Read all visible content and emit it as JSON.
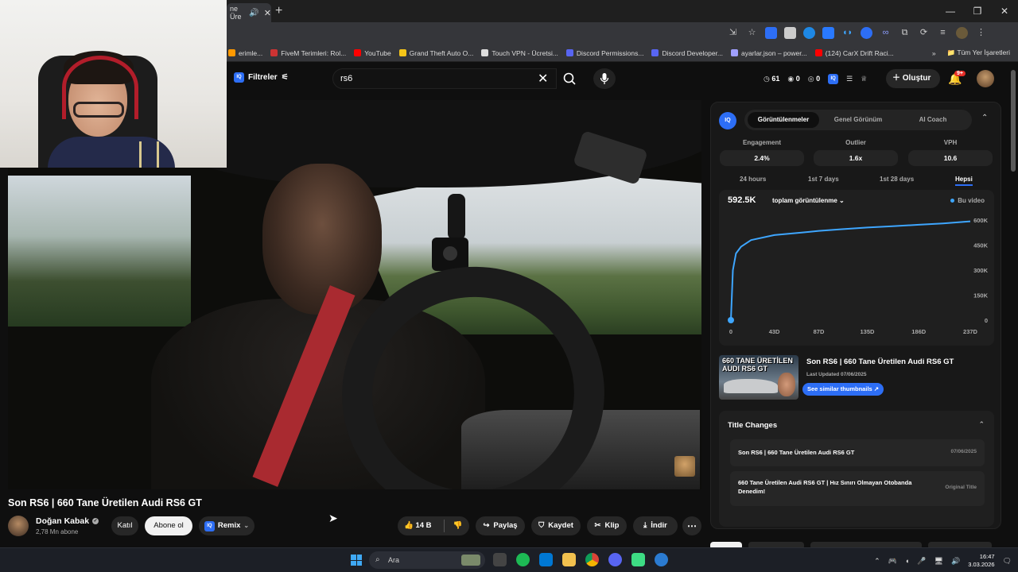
{
  "browser": {
    "active_tab_title": "ne Üre",
    "bookmarks": [
      {
        "label": "erimle...",
        "color": "#ff9900"
      },
      {
        "label": "FiveM Terimleri: Rol...",
        "color": "#cc3333"
      },
      {
        "label": "YouTube",
        "color": "#ff0000"
      },
      {
        "label": "Grand Theft Auto O...",
        "color": "#f5c518"
      },
      {
        "label": "Touch VPN - Ücretsi...",
        "color": "#dddddd"
      },
      {
        "label": "Discord Permissions...",
        "color": "#5865f2"
      },
      {
        "label": "Discord Developer...",
        "color": "#5865f2"
      },
      {
        "label": "ayarlar.json – power...",
        "color": "#a0a0ff"
      },
      {
        "label": "(124) CarX Drift Raci...",
        "color": "#ff0000"
      }
    ],
    "all_bookmarks": "Tüm Yer İşaretleri"
  },
  "header": {
    "filters_label": "Filtreler",
    "search_value": "rs6",
    "stats": [
      "61",
      "0",
      "0"
    ],
    "create_label": "Oluştur",
    "notif_count": "9+"
  },
  "video": {
    "title": "Son RS6 | 660 Tane Üretilen Audi RS6 GT",
    "channel": "Doğan Kabak",
    "subscribers": "2,78 Mn abone",
    "join_label": "Katıl",
    "subscribe_label": "Abone ol",
    "remix_label": "Remix",
    "likes": "14 B",
    "share_label": "Paylaş",
    "save_label": "Kaydet",
    "clip_label": "Klip",
    "download_label": "İndir"
  },
  "panel": {
    "tabs": [
      "Görüntülenmeler",
      "Genel Görünüm",
      "AI Coach"
    ],
    "metrics": [
      {
        "label": "Engagement",
        "value": "2.4%"
      },
      {
        "label": "Outlier",
        "value": "1.6x"
      },
      {
        "label": "VPH",
        "value": "10.6"
      }
    ],
    "periods": [
      "24 hours",
      "1st 7 days",
      "1st 28 days",
      "Hepsi"
    ],
    "active_period": "Hepsi",
    "total_views": "592.5K",
    "metric_select": "toplam görüntülenme",
    "legend": "Bu video",
    "thumb_text": "660 TANE ÜRETİLEN AUDI RS6 GT",
    "thumb_title": "Son RS6 | 660 Tane Üretilen Audi RS6 GT",
    "last_updated": "Last Updated 07/06/2025",
    "similar_label": "See similar thumbnails",
    "title_changes_heading": "Title Changes",
    "title_changes": [
      {
        "title": "Son RS6 | 660 Tane Üretilen Audi RS6 GT",
        "date": "07/06/2025"
      },
      {
        "title": "660 Tane Üretilen Audi RS6 GT | Hız Sınırı Olmayan Otobanda Denedim!",
        "date": "Original Title"
      }
    ]
  },
  "chart_data": {
    "type": "line",
    "x": [
      0,
      2,
      5,
      10,
      20,
      43,
      70,
      87,
      110,
      135,
      160,
      186,
      210,
      237
    ],
    "y": [
      0,
      300,
      400,
      440,
      480,
      510,
      525,
      535,
      545,
      555,
      563,
      572,
      580,
      592.5
    ],
    "x_ticks": [
      "0",
      "43D",
      "87D",
      "135D",
      "186D",
      "237D"
    ],
    "x_tick_values": [
      0,
      43,
      87,
      135,
      186,
      237
    ],
    "y_ticks": [
      "0",
      "150K",
      "300K",
      "450K",
      "600K"
    ],
    "y_tick_values": [
      0,
      150,
      300,
      450,
      600
    ],
    "xlim": [
      0,
      237
    ],
    "ylim": [
      0,
      600
    ],
    "series_color": "#3ea6ff"
  },
  "taskbar": {
    "search_label": "Ara",
    "time": "16:47",
    "date": "3.03.2026"
  }
}
